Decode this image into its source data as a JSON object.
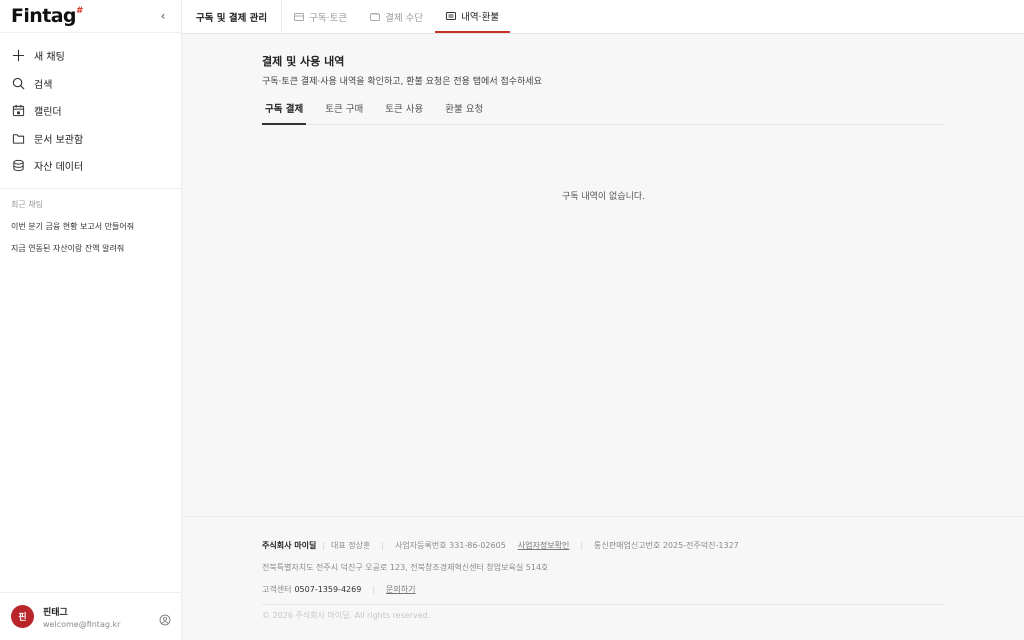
{
  "brand": {
    "name": "Fintag",
    "accent": "#c9302c"
  },
  "sidebar": {
    "collapse_icon": "chevron-left-icon",
    "items": [
      {
        "label": "새 채팅",
        "icon": "plus-icon"
      },
      {
        "label": "검색",
        "icon": "search-icon"
      },
      {
        "label": "캘린더",
        "icon": "calendar-icon"
      },
      {
        "label": "문서 보관함",
        "icon": "folder-icon"
      },
      {
        "label": "자산 데이터",
        "icon": "database-icon"
      }
    ],
    "recent_title": "최근 채팅",
    "recent_items": [
      "이번 분기 금융 현황 보고서 만들어줘",
      "지금 연동된 자산이랑 잔액 알려줘"
    ]
  },
  "user": {
    "avatar_text": "핀",
    "name": "핀태그",
    "email": "welcome@fintag.kr",
    "settings_icon": "user-settings-icon"
  },
  "topbar": {
    "title": "구독 및 결제 관리",
    "tabs": [
      {
        "label": "구독·토큰",
        "icon": "card-icon",
        "active": false
      },
      {
        "label": "결제 수단",
        "icon": "wallet-icon",
        "active": false
      },
      {
        "label": "내역·환불",
        "icon": "receipt-icon",
        "active": true
      }
    ]
  },
  "page": {
    "title": "결제 및 사용 내역",
    "description": "구독·토큰 결제·사용 내역을 확인하고, 환불 요청은 전용 탭에서 접수하세요",
    "subtabs": [
      {
        "label": "구독 결제",
        "active": true
      },
      {
        "label": "토큰 구매",
        "active": false
      },
      {
        "label": "토큰 사용",
        "active": false
      },
      {
        "label": "환불 요청",
        "active": false
      }
    ],
    "empty_message": "구독 내역이 없습니다."
  },
  "footer": {
    "company": "주식회사 마이딜",
    "ceo": "대표 정상훈",
    "biz_no": "사업자등록번호 331-86-02605",
    "biz_info_link": "사업자정보확인",
    "ecommerce_no": "통신판매업신고번호 2025-전주덕진-1327",
    "address": "전북특별자치도 전주시 덕진구 오공로 123, 전북창조경제혁신센터 창업보육실 514호",
    "cs_label": "고객센터",
    "cs_phone": "0507-1359-4269",
    "contact_link": "문의하기",
    "copyright": "© 2026 주식회사 마이딜. All rights reserved."
  }
}
